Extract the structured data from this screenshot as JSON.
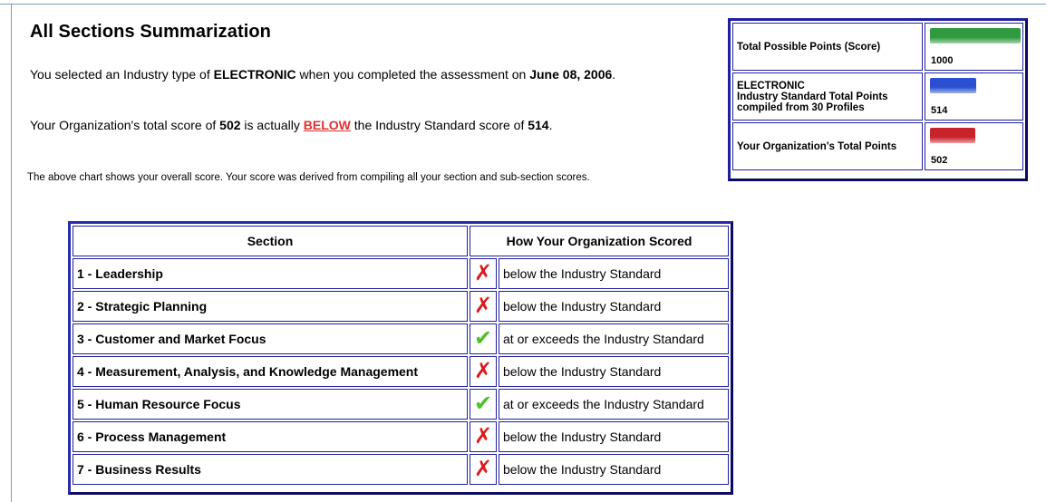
{
  "header": {
    "title": "All Sections Summarization"
  },
  "summary": {
    "p1_a": "You selected an Industry type of ",
    "industry": "ELECTRONIC",
    "p1_b": " when you completed the assessment on ",
    "date": "June 08, 2006",
    "p1_c": ".",
    "p2_a": "Your Organization's total score of ",
    "org_score": "502",
    "p2_b": " is actually ",
    "comparison": "BELOW",
    "p2_c": " the Industry Standard score of ",
    "industry_score": "514",
    "p2_d": ".",
    "note": "The above chart shows your overall score. Your score was derived from compiling all your section and sub-section scores."
  },
  "score_chart": {
    "max": 1000,
    "rows": [
      {
        "label": "Total Possible Points (Score)",
        "label2": "",
        "label3": "",
        "value": 1000,
        "value_text": "1000",
        "color": "#2f9a3f"
      },
      {
        "label": "ELECTRONIC",
        "label2": "Industry Standard Total Points",
        "label3": "compiled from 30 Profiles",
        "value": 514,
        "value_text": "514",
        "color": "#2a4fd0"
      },
      {
        "label": "Your Organization's Total Points",
        "label2": "",
        "label3": "",
        "value": 502,
        "value_text": "502",
        "color": "#c8222a"
      }
    ]
  },
  "sections_table": {
    "header_section": "Section",
    "header_score": "How Your Organization Scored",
    "rows": [
      {
        "section": "1 - Leadership",
        "icon": "x-icon",
        "mark": "✗",
        "result": "below the Industry Standard"
      },
      {
        "section": "2 - Strategic Planning",
        "icon": "x-icon",
        "mark": "✗",
        "result": "below the Industry Standard"
      },
      {
        "section": "3 - Customer and Market Focus",
        "icon": "check-icon",
        "mark": "✔",
        "result": "at or exceeds the Industry Standard"
      },
      {
        "section": "4 - Measurement, Analysis, and Knowledge Management",
        "icon": "x-icon",
        "mark": "✗",
        "result": "below the Industry Standard"
      },
      {
        "section": "5 - Human Resource Focus",
        "icon": "check-icon",
        "mark": "✔",
        "result": "at or exceeds the Industry Standard"
      },
      {
        "section": "6 - Process Management",
        "icon": "x-icon",
        "mark": "✗",
        "result": "below the Industry Standard"
      },
      {
        "section": "7 - Business Results",
        "icon": "x-icon",
        "mark": "✗",
        "result": "below the Industry Standard"
      }
    ]
  }
}
